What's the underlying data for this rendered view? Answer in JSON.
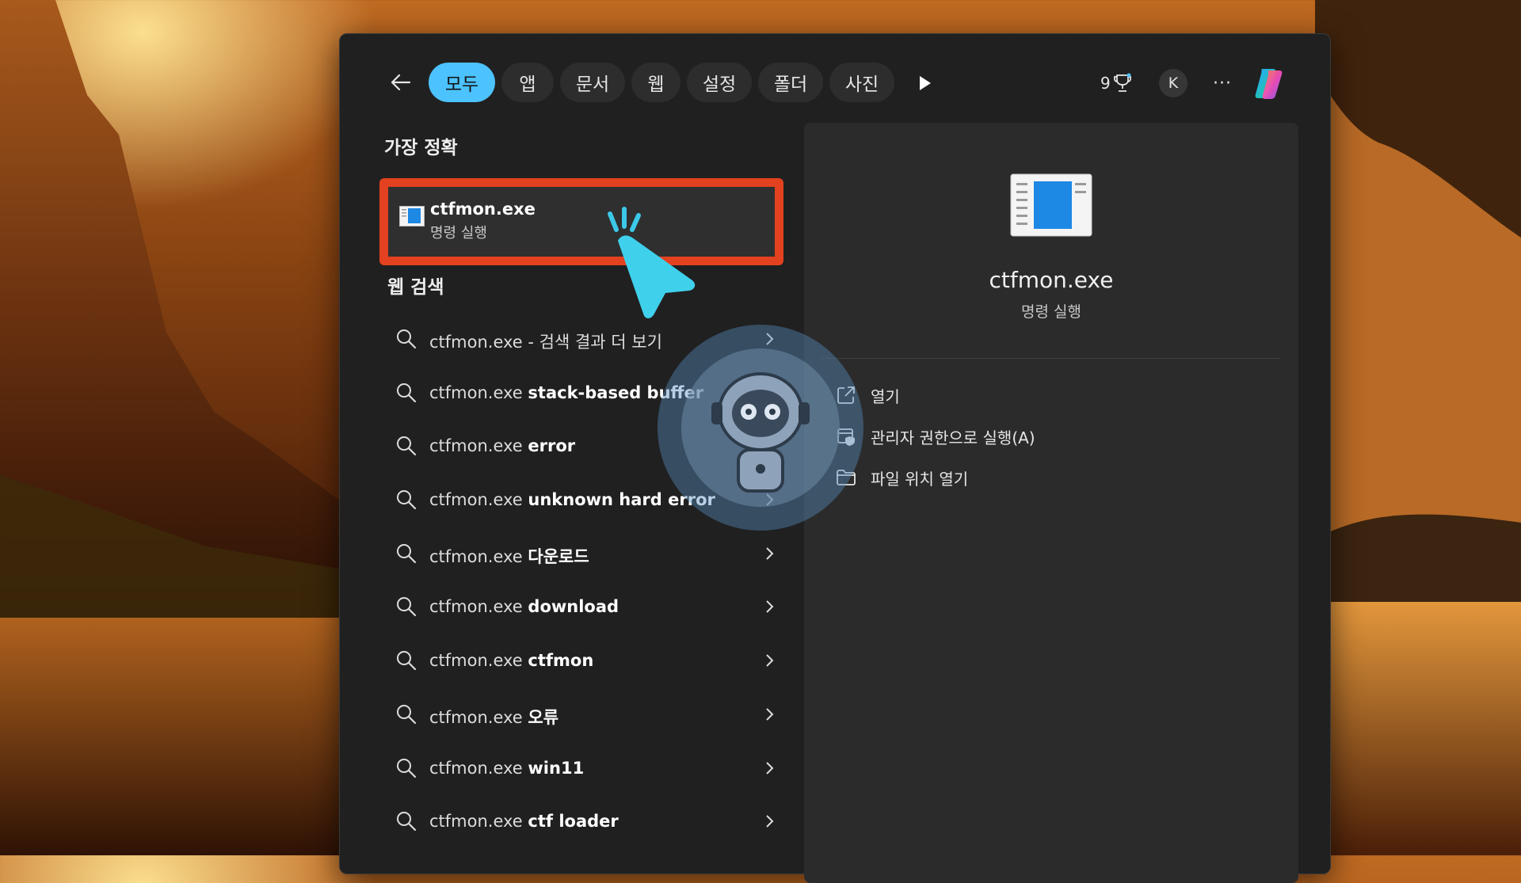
{
  "filters": {
    "back_label": "←",
    "tabs": [
      {
        "label": "모두",
        "active": true
      },
      {
        "label": "앱"
      },
      {
        "label": "문서"
      },
      {
        "label": "웹"
      },
      {
        "label": "설정"
      },
      {
        "label": "폴더"
      },
      {
        "label": "사진"
      }
    ],
    "points": "9",
    "avatar_initial": "K",
    "more_label": "···"
  },
  "best_match": {
    "section_title": "가장 정확",
    "title": "ctfmon.exe",
    "subtitle": "명령 실행"
  },
  "web_search": {
    "section_title": "웹 검색",
    "items": [
      {
        "query": "ctfmon.exe",
        "suffix": " - 검색 결과 더 보기",
        "bold": ""
      },
      {
        "query": "ctfmon.exe",
        "suffix": "",
        "bold": "stack-based buffer"
      },
      {
        "query": "ctfmon.exe",
        "suffix": "",
        "bold": "error"
      },
      {
        "query": "ctfmon.exe",
        "suffix": "",
        "bold": "unknown hard error"
      },
      {
        "query": "ctfmon.exe",
        "suffix": "",
        "bold": "다운로드"
      },
      {
        "query": "ctfmon.exe",
        "suffix": "",
        "bold": "download"
      },
      {
        "query": "ctfmon.exe",
        "suffix": "",
        "bold": "ctfmon"
      },
      {
        "query": "ctfmon.exe",
        "suffix": "",
        "bold": "오류"
      },
      {
        "query": "ctfmon.exe",
        "suffix": "",
        "bold": "win11"
      },
      {
        "query": "ctfmon.exe",
        "suffix": "",
        "bold": "ctf loader"
      }
    ]
  },
  "detail": {
    "title": "ctfmon.exe",
    "subtitle": "명령 실행",
    "actions": [
      {
        "label": "열기",
        "icon": "open-external-icon"
      },
      {
        "label": "관리자 권한으로 실행(A)",
        "icon": "run-as-admin-icon"
      },
      {
        "label": "파일 위치 열기",
        "icon": "folder-icon"
      }
    ]
  },
  "colors": {
    "accent": "#4cc2ff",
    "highlight_box": "#e3411f",
    "panel": "#202020",
    "detail_panel": "#2b2b2b"
  }
}
